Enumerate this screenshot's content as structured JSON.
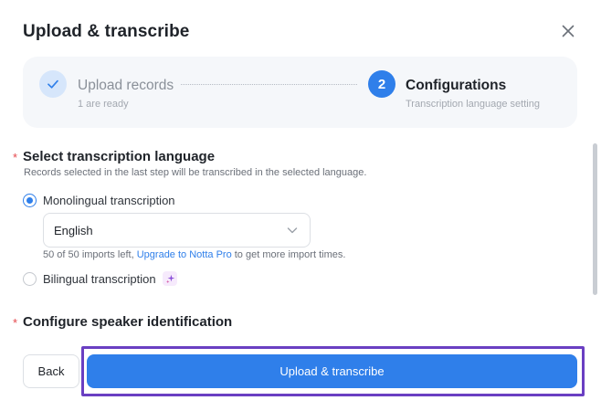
{
  "dialog": {
    "title": "Upload & transcribe",
    "close_icon": "close-icon"
  },
  "stepper": {
    "steps": [
      {
        "label": "Upload records",
        "sub": "1 are ready",
        "state": "done",
        "icon": "check-icon"
      },
      {
        "label": "Configurations",
        "sub": "Transcription language setting",
        "state": "active",
        "number": "2"
      }
    ]
  },
  "language_section": {
    "required_mark": "*",
    "title": "Select transcription language",
    "description": "Records selected in the last step will be transcribed in the selected language.",
    "options": [
      {
        "label": "Monolingual transcription",
        "selected": true
      },
      {
        "label": "Bilingual transcription",
        "selected": false,
        "badge_icon": "sparkle-icon"
      }
    ],
    "language_select": {
      "value": "English",
      "icon": "chevron-down-icon"
    },
    "quota": {
      "prefix": "50 of 50 imports left,",
      "link": "Upgrade to Notta Pro",
      "suffix": "to get more import times."
    }
  },
  "speaker_section": {
    "required_mark": "*",
    "title": "Configure speaker identification"
  },
  "footer": {
    "back_label": "Back",
    "primary_label": "Upload & transcribe"
  },
  "colors": {
    "accent": "#2f7fea",
    "required": "#e5484d",
    "highlight_frame": "#6a3fc2",
    "stepper_bg": "#f5f7fa"
  }
}
